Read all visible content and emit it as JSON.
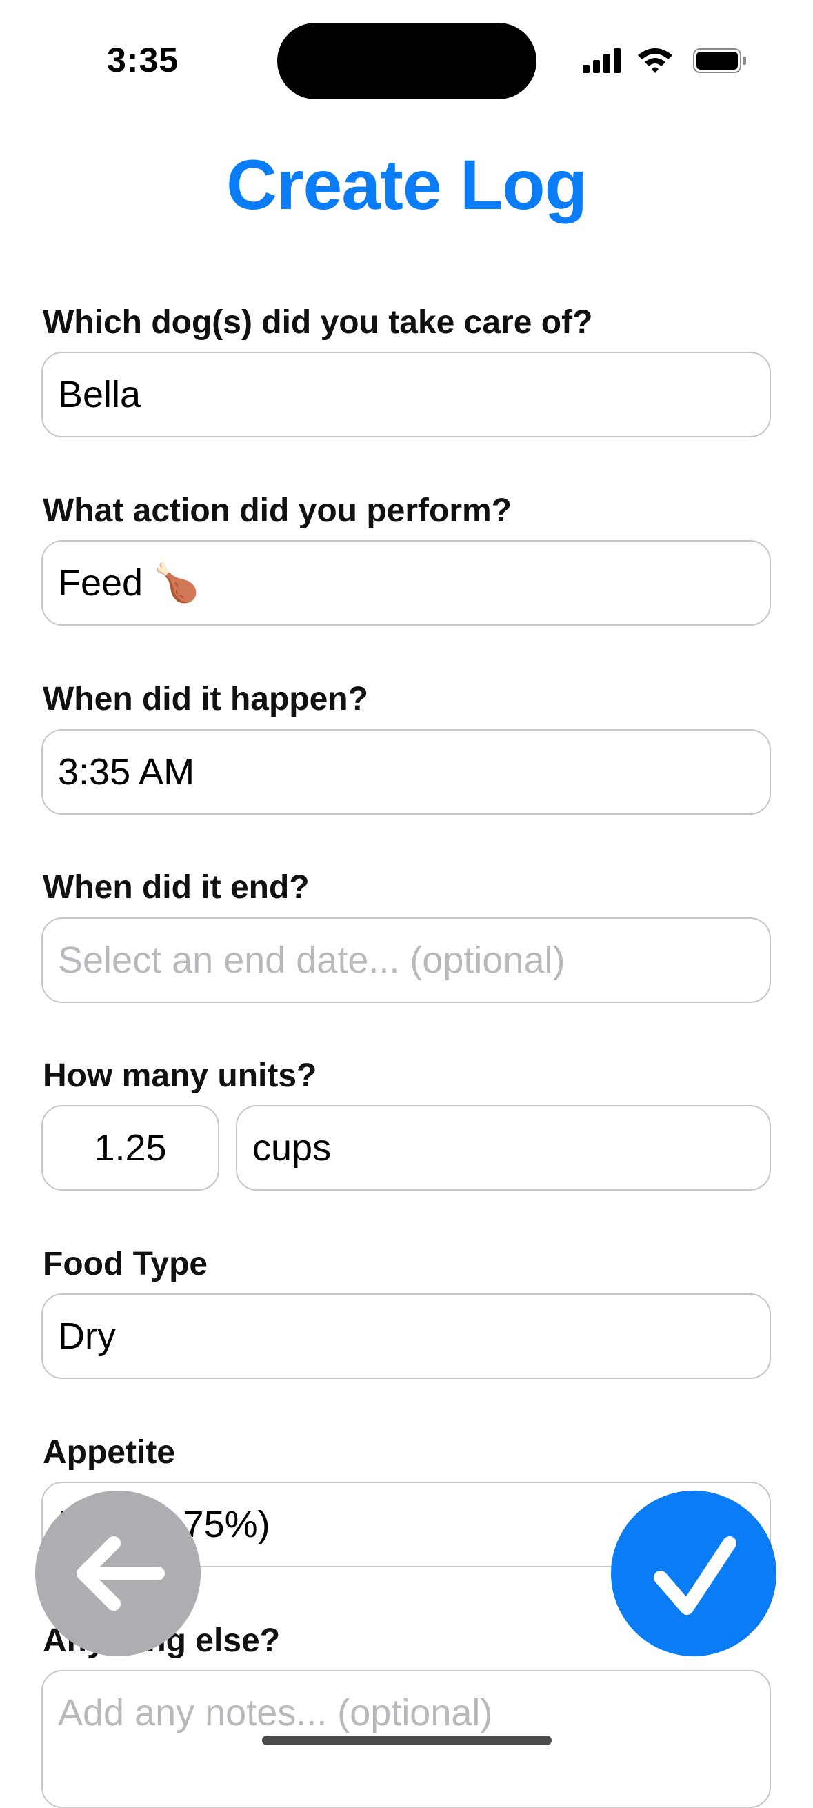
{
  "status_bar": {
    "time": "3:35"
  },
  "title": "Create Log",
  "form": {
    "dogs": {
      "label": "Which dog(s) did you take care of?",
      "value": "Bella"
    },
    "action": {
      "label": "What action did you perform?",
      "value": "Feed 🍗"
    },
    "start": {
      "label": "When did it happen?",
      "value": "3:35 AM"
    },
    "end": {
      "label": "When did it end?",
      "placeholder": "Select an end date... (optional)"
    },
    "units": {
      "label": "How many units?",
      "amount": "1.25",
      "unit": "cups"
    },
    "food_type": {
      "label": "Food Type",
      "value": "Dry"
    },
    "appetite": {
      "label": "Appetite",
      "value": "Most (~75%)"
    },
    "notes": {
      "label": "Anything else?",
      "placeholder": "Add any notes... (optional)"
    }
  },
  "icons": {
    "back": "arrow-left-icon",
    "confirm": "checkmark-icon",
    "signal": "cellular-signal-icon",
    "wifi": "wifi-icon",
    "battery": "battery-icon"
  },
  "colors": {
    "accent": "#0a7cf5",
    "back_button": "#aeaeb2"
  }
}
